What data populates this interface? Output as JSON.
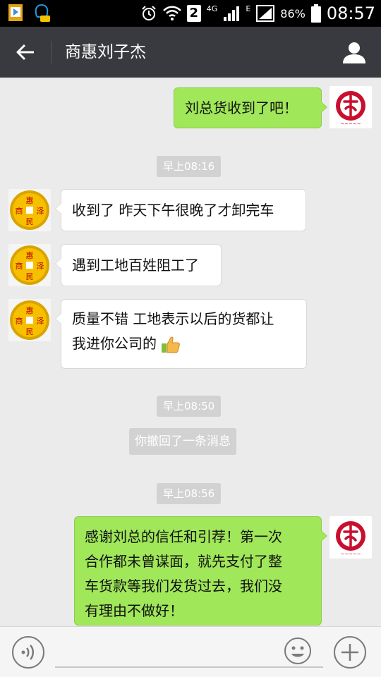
{
  "status_bar": {
    "sim": "2",
    "network_label": "4G",
    "network_label_2": "E",
    "battery": "86%",
    "time": "08:57"
  },
  "header": {
    "title": "商惠刘子杰"
  },
  "messages": [
    {
      "from": "me",
      "text": "刘总货收到了吧！"
    },
    {
      "time": "早上08:16"
    },
    {
      "from": "contact",
      "text": "收到了 昨天下午很晚了才卸完车"
    },
    {
      "from": "contact",
      "text": "遇到工地百姓阻工了"
    },
    {
      "from": "contact",
      "line1": "质量不错 工地表示以后的货都让",
      "line2": "我进你公司的"
    },
    {
      "time": "早上08:50"
    },
    {
      "system": "你撤回了一条消息"
    },
    {
      "time": "早上08:56"
    },
    {
      "from": "me",
      "lines": [
        "感谢刘总的信任和引荐！第一次",
        "合作都未曾谋面，就先支付了整",
        "车货款等我们发货过去，我们没",
        "有理由不做好！"
      ]
    }
  ],
  "contact_avatar_chars": [
    "惠",
    "商",
    "泽",
    "民"
  ],
  "icons": [
    "back-arrow-icon",
    "profile-icon",
    "voice-icon",
    "emoji-icon",
    "plus-icon",
    "thumbs-up-icon",
    "alarm-icon",
    "wifi-icon",
    "signal-icon",
    "battery-icon"
  ],
  "colors": {
    "outgoing_bubble": "#a0e759",
    "header_bg": "#393a3f",
    "chat_bg": "#ebebeb"
  }
}
